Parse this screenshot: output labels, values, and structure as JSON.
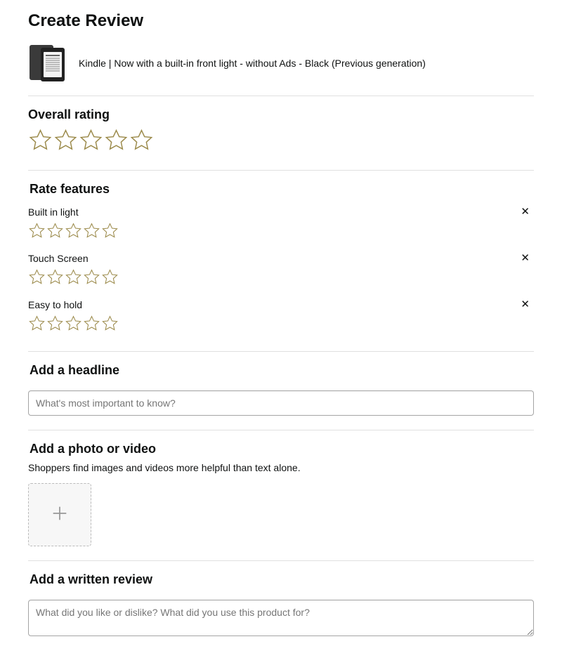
{
  "page_title": "Create Review",
  "product": {
    "name": "Kindle | Now with a built-in front light - without Ads - Black (Previous generation)"
  },
  "overall_rating": {
    "label": "Overall rating",
    "value": 0
  },
  "rate_features": {
    "label": "Rate features",
    "features": [
      {
        "label": "Built in light",
        "value": 0
      },
      {
        "label": "Touch Screen",
        "value": 0
      },
      {
        "label": "Easy to hold",
        "value": 0
      }
    ]
  },
  "headline": {
    "label": "Add a headline",
    "placeholder": "What's most important to know?",
    "value": ""
  },
  "media": {
    "label": "Add a photo or video",
    "helper": "Shoppers find images and videos more helpful than text alone."
  },
  "written_review": {
    "label": "Add a written review",
    "placeholder": "What did you like or dislike? What did you use this product for?",
    "value": ""
  }
}
